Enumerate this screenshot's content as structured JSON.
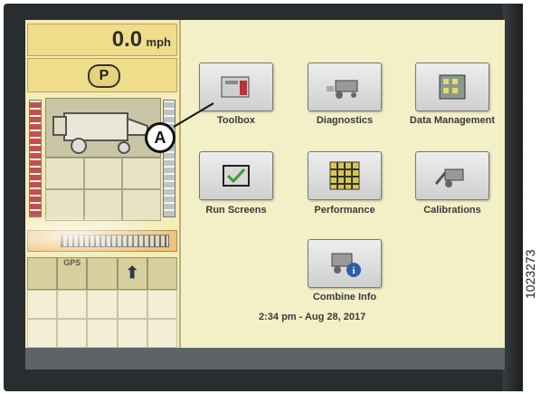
{
  "speed": {
    "value": "0.0",
    "unit": "mph"
  },
  "park_indicator": "P",
  "tools_strip": {
    "gps_label": "GPS"
  },
  "main_menu": {
    "items": [
      {
        "label": "Toolbox",
        "icon": "toolbox-icon"
      },
      {
        "label": "Diagnostics",
        "icon": "diagnostics-icon"
      },
      {
        "label": "Data Management",
        "icon": "data-management-icon"
      },
      {
        "label": "Run Screens",
        "icon": "run-screens-icon"
      },
      {
        "label": "Performance",
        "icon": "performance-icon"
      },
      {
        "label": "Calibrations",
        "icon": "calibrations-icon"
      },
      {
        "label": "Combine Info",
        "icon": "combine-info-icon"
      }
    ]
  },
  "datetime": "2:34 pm - Aug 28, 2017",
  "callout": {
    "letter": "A"
  },
  "figure_number": "1023273",
  "colors": {
    "screen_bg": "#f3efc7",
    "left_panel": "#f5ecb7",
    "taskbar": "#5e6366"
  }
}
